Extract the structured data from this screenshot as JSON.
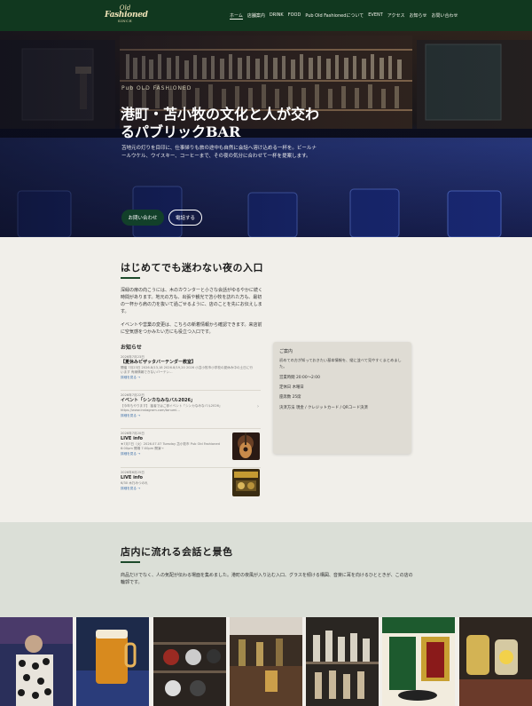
{
  "header": {
    "logo": {
      "line1": "Old",
      "line2": "Fashioned",
      "line3": "SINCE"
    },
    "nav": [
      "ホーム",
      "店舗案内",
      "DRINK",
      "FOOD",
      "Pub Old Fashionedについて",
      "EVENT",
      "アクセス",
      "お知らせ",
      "お問い合わせ"
    ]
  },
  "hero": {
    "kicker": "Pub OLD FASHIONED",
    "title": "港町・苫小牧の文化と人が交わるパブリックBAR",
    "description": "苫地元の灯りを目印に、仕事帰りも旅の途中も自然に会話へ溶け込める一杯を。ビールナールウケル、ウイスキー、コーヒーまで、その夜の気分に合わせて一杯を提案します。",
    "btn_contact": "お問い合わせ",
    "btn_call": "電話する"
  },
  "intro": {
    "title": "はじめてでも迷わない夜の入口",
    "p1": "深緑の扉の向こうには、木のカウンターと小さな会話がゆるやかに続く時間があります。地元の方も、出張や観光で苫小牧を訪れた方も、最初の一杯から肩の力を抜いて過ごせるように、店のことを先にお伝えします。",
    "p2": "イベントや営業の変更は、こちらの新着情報から確認できます。来店前に空気感をつかみたい方にも役立つ入口です。",
    "news_heading": "お知らせ"
  },
  "news": [
    {
      "date": "2026年7月23日",
      "title": "【夏休みピザッタバーテンダー教室】",
      "excerpt": "開催 7月23日 2026.8/13,18 2026.8/19,20 2026 小苫小牧市小学校の夏休み中の土日に行います 有線情報できないバーテン…",
      "more": "詳細を見る →"
    },
    {
      "date": "2026年7月22日",
      "title": "イベント「シンカなみなバル2026」",
      "excerpt": "【今年もやります】 猛者ではご参イベント「シンカなみなバル2026」 https://www.instagram.com/tanumi…",
      "more": "詳細を見る →"
    },
    {
      "date": "2026年7月20日",
      "title": "LIVE info",
      "excerpt": "★7月7日（火）2026.07.07 Tuesday 苫小牧市 Pub Old Fashioned 6:00pm 開場 7:00pm 開演→",
      "more": "詳細を見る →"
    },
    {
      "date": "2026年6月25日",
      "title": "LIVE info",
      "excerpt": "6/30 木乃みつのれ",
      "more": "詳細を見る →"
    }
  ],
  "info_card": {
    "heading": "ご案内",
    "description": "初めての方が知っておきたい基本情報を、縦に並べて見やすくまとめました。",
    "hours": "営業時間 20:00〜2:00",
    "closed": "定休日 木曜日",
    "seats": "座席数 25席",
    "payment": "決済方法 現金 / クレジットカード / QRコード決済"
  },
  "section2": {
    "title": "店内に流れる会話と景色",
    "description": "商品だけでなく、人の気配が伝わる場面を集めました。港町の夜風が入り込む入口、グラスを傾ける構図、音楽に耳を向けるひとときが、この店の輪郭です。"
  },
  "gallery": [
    "guitarist",
    "beer",
    "shelf",
    "bar-counter",
    "bottles",
    "storefront",
    "jars"
  ],
  "colors": {
    "header_bg": "#11381f",
    "accent_green": "#12402a",
    "page_bg": "#f1efea",
    "section_bg": "#dbdfd7",
    "card_bg": "#dfdcd4",
    "link": "#3a6ea8"
  }
}
